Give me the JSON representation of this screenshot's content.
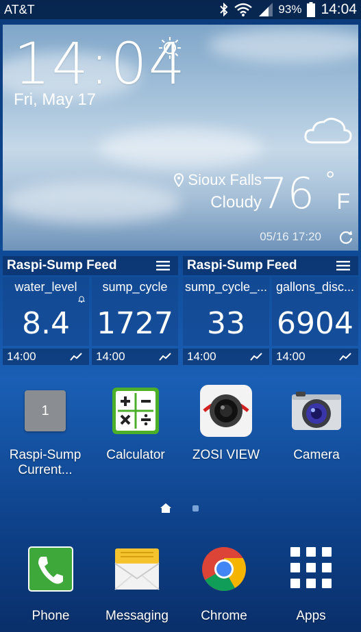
{
  "status_bar": {
    "carrier": "AT&T",
    "battery": "93%",
    "time": "14:04"
  },
  "weather": {
    "time": "14:04",
    "date": "Fri, May 17",
    "location": "Sioux Falls",
    "condition": "Cloudy",
    "temperature": "76",
    "degree_symbol": "°",
    "unit": "F",
    "updated": "05/16 17:20"
  },
  "feeds": [
    {
      "title": "Raspi-Sump Feed",
      "tiles": [
        {
          "name": "water_level",
          "value": "8.4",
          "time": "14:00"
        },
        {
          "name": "sump_cycle",
          "value": "1727",
          "time": "14:00"
        }
      ]
    },
    {
      "title": "Raspi-Sump Feed",
      "tiles": [
        {
          "name": "sump_cycle_...",
          "value": "33",
          "time": "14:00"
        },
        {
          "name": "gallons_disc...",
          "value": "6904",
          "time": "14:00"
        }
      ]
    }
  ],
  "apps": [
    {
      "label": "Raspi-Sump Current...",
      "icon": "raspi-sump-icon",
      "badge": "1"
    },
    {
      "label": "Calculator",
      "icon": "calculator-icon"
    },
    {
      "label": "ZOSI VIEW",
      "icon": "zosi-camera-icon"
    },
    {
      "label": "Camera",
      "icon": "camera-icon"
    }
  ],
  "dock": [
    {
      "label": "Phone",
      "icon": "phone-icon"
    },
    {
      "label": "Messaging",
      "icon": "messaging-icon"
    },
    {
      "label": "Chrome",
      "icon": "chrome-icon"
    },
    {
      "label": "Apps",
      "icon": "apps-grid-icon"
    }
  ]
}
